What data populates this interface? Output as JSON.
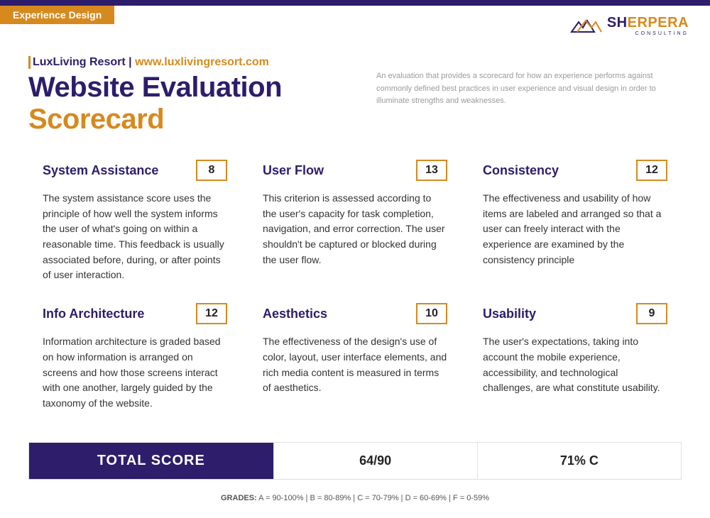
{
  "badge": "Experience Design",
  "logo": {
    "name1": "SH",
    "name2": "ERPERA",
    "sub": "CONSULTING"
  },
  "company": "LuxLiving Resort",
  "url": "www.luxlivingresort.com",
  "title_main": "Website Evaluation",
  "title_accent": "Scorecard",
  "description": "An evaluation that provides a scorecard for how an experience performs against commonly defined best practices in user experience and visual design in order to illuminate strengths and weaknesses.",
  "cards": [
    {
      "title": "System Assistance",
      "score": "8",
      "body": "The system assistance score uses the principle of how well the system informs the user of what's going on within a reasonable time. This feedback is usually associated before, during, or after points of user interaction."
    },
    {
      "title": "User Flow",
      "score": "13",
      "body": "This criterion is assessed according to the user's capacity for task completion, navigation, and error correction. The user shouldn't be captured or blocked during the user flow."
    },
    {
      "title": "Consistency",
      "score": "12",
      "body": "The effectiveness and usability of how items are labeled and arranged so that a user can freely interact with the experience are examined by the consistency principle"
    },
    {
      "title": "Info Architecture",
      "score": "12",
      "body": "Information architecture is graded based on how information is arranged on screens and how those screens interact with one another, largely guided by the taxonomy of the website."
    },
    {
      "title": "Aesthetics",
      "score": "10",
      "body": "The effectiveness of the design's use of color, layout, user interface elements, and rich media content is measured in terms of aesthetics."
    },
    {
      "title": "Usability",
      "score": "9",
      "body": "The user's expectations, taking into account the mobile experience, accessibility, and technological challenges, are what constitute usability."
    }
  ],
  "total_label": "TOTAL SCORE",
  "total_score": "64/90",
  "total_grade": "71% C",
  "gradeskey_label": "GRADES:",
  "gradeskey": " A = 90-100% | B = 80-89% | C = 70-79% | D = 60-69% | F = 0-59%"
}
